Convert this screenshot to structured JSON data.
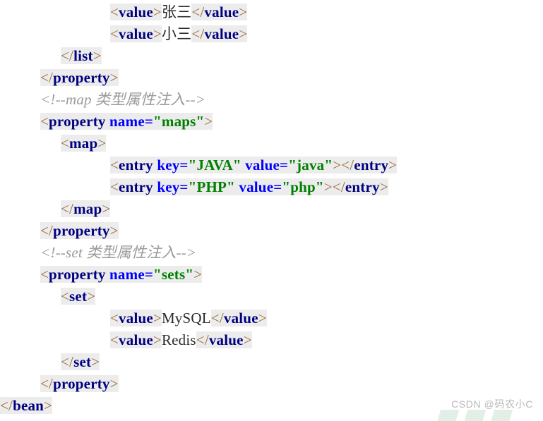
{
  "code": {
    "language": "xml",
    "lines": [
      {
        "indent": 5,
        "tokens": [
          {
            "t": "brk",
            "s": "<",
            "hl": true
          },
          {
            "t": "tag",
            "s": "value",
            "hl": true
          },
          {
            "t": "brk",
            "s": ">",
            "hl": true
          },
          {
            "t": "txt",
            "s": "张三",
            "hl": false
          },
          {
            "t": "brk",
            "s": "</",
            "hl": true
          },
          {
            "t": "tag",
            "s": "value",
            "hl": true
          },
          {
            "t": "brk",
            "s": ">",
            "hl": true
          }
        ]
      },
      {
        "indent": 5,
        "tokens": [
          {
            "t": "brk",
            "s": "<",
            "hl": true
          },
          {
            "t": "tag",
            "s": "value",
            "hl": true
          },
          {
            "t": "brk",
            "s": ">",
            "hl": true
          },
          {
            "t": "txt",
            "s": "小三",
            "hl": false
          },
          {
            "t": "brk",
            "s": "</",
            "hl": true
          },
          {
            "t": "tag",
            "s": "value",
            "hl": true
          },
          {
            "t": "brk",
            "s": ">",
            "hl": true
          }
        ]
      },
      {
        "indent": 3,
        "tokens": [
          {
            "t": "brk",
            "s": "</",
            "hl": true
          },
          {
            "t": "tag",
            "s": "list",
            "hl": true
          },
          {
            "t": "brk",
            "s": ">",
            "hl": true
          }
        ]
      },
      {
        "indent": 2,
        "tokens": [
          {
            "t": "brk",
            "s": "</",
            "hl": true
          },
          {
            "t": "tag",
            "s": "property",
            "hl": true
          },
          {
            "t": "brk",
            "s": ">",
            "hl": true
          }
        ]
      },
      {
        "indent": 2,
        "tokens": [
          {
            "t": "cmt",
            "s": "<!--map 类型属性注入-->",
            "hl": false
          }
        ]
      },
      {
        "indent": 2,
        "tokens": [
          {
            "t": "brk",
            "s": "<",
            "hl": true
          },
          {
            "t": "tag",
            "s": "property",
            "hl": true
          },
          {
            "t": "txt",
            "s": " ",
            "hl": true
          },
          {
            "t": "attr",
            "s": "name=",
            "hl": true
          },
          {
            "t": "val",
            "s": "\"maps\"",
            "hl": true
          },
          {
            "t": "brk",
            "s": ">",
            "hl": true
          }
        ]
      },
      {
        "indent": 3,
        "tokens": [
          {
            "t": "brk",
            "s": "<",
            "hl": true
          },
          {
            "t": "tag",
            "s": "map",
            "hl": true
          },
          {
            "t": "brk",
            "s": ">",
            "hl": true
          }
        ]
      },
      {
        "indent": 5,
        "tokens": [
          {
            "t": "brk",
            "s": "<",
            "hl": true
          },
          {
            "t": "tag",
            "s": "entry",
            "hl": true
          },
          {
            "t": "txt",
            "s": " ",
            "hl": true
          },
          {
            "t": "attr",
            "s": "key=",
            "hl": true
          },
          {
            "t": "val",
            "s": "\"JAVA\"",
            "hl": true
          },
          {
            "t": "txt",
            "s": " ",
            "hl": true
          },
          {
            "t": "attr",
            "s": "value=",
            "hl": true
          },
          {
            "t": "val",
            "s": "\"java\"",
            "hl": true
          },
          {
            "t": "brk",
            "s": ">",
            "hl": true
          },
          {
            "t": "brk",
            "s": "</",
            "hl": true
          },
          {
            "t": "tag",
            "s": "entry",
            "hl": true
          },
          {
            "t": "brk",
            "s": ">",
            "hl": true
          }
        ]
      },
      {
        "indent": 5,
        "tokens": [
          {
            "t": "brk",
            "s": "<",
            "hl": true
          },
          {
            "t": "tag",
            "s": "entry",
            "hl": true
          },
          {
            "t": "txt",
            "s": " ",
            "hl": true
          },
          {
            "t": "attr",
            "s": "key=",
            "hl": true
          },
          {
            "t": "val",
            "s": "\"PHP\"",
            "hl": true
          },
          {
            "t": "txt",
            "s": " ",
            "hl": true
          },
          {
            "t": "attr",
            "s": "value=",
            "hl": true
          },
          {
            "t": "val",
            "s": "\"php\"",
            "hl": true
          },
          {
            "t": "brk",
            "s": ">",
            "hl": true
          },
          {
            "t": "brk",
            "s": "</",
            "hl": true
          },
          {
            "t": "tag",
            "s": "entry",
            "hl": true
          },
          {
            "t": "brk",
            "s": ">",
            "hl": true
          }
        ]
      },
      {
        "indent": 3,
        "tokens": [
          {
            "t": "brk",
            "s": "</",
            "hl": true
          },
          {
            "t": "tag",
            "s": "map",
            "hl": true
          },
          {
            "t": "brk",
            "s": ">",
            "hl": true
          }
        ]
      },
      {
        "indent": 2,
        "tokens": [
          {
            "t": "brk",
            "s": "</",
            "hl": true
          },
          {
            "t": "tag",
            "s": "property",
            "hl": true
          },
          {
            "t": "brk",
            "s": ">",
            "hl": true
          }
        ]
      },
      {
        "indent": 2,
        "tokens": [
          {
            "t": "cmt",
            "s": "<!--set 类型属性注入-->",
            "hl": false
          }
        ]
      },
      {
        "indent": 2,
        "tokens": [
          {
            "t": "brk",
            "s": "<",
            "hl": true
          },
          {
            "t": "tag",
            "s": "property",
            "hl": true
          },
          {
            "t": "txt",
            "s": " ",
            "hl": true
          },
          {
            "t": "attr",
            "s": "name=",
            "hl": true
          },
          {
            "t": "val",
            "s": "\"sets\"",
            "hl": true
          },
          {
            "t": "brk",
            "s": ">",
            "hl": true
          }
        ]
      },
      {
        "indent": 3,
        "tokens": [
          {
            "t": "brk",
            "s": "<",
            "hl": true
          },
          {
            "t": "tag",
            "s": "set",
            "hl": true
          },
          {
            "t": "brk",
            "s": ">",
            "hl": true
          }
        ]
      },
      {
        "indent": 5,
        "tokens": [
          {
            "t": "brk",
            "s": "<",
            "hl": true
          },
          {
            "t": "tag",
            "s": "value",
            "hl": true
          },
          {
            "t": "brk",
            "s": ">",
            "hl": true
          },
          {
            "t": "txt",
            "s": "MySQL",
            "hl": false
          },
          {
            "t": "brk",
            "s": "</",
            "hl": true
          },
          {
            "t": "tag",
            "s": "value",
            "hl": true
          },
          {
            "t": "brk",
            "s": ">",
            "hl": true
          }
        ]
      },
      {
        "indent": 5,
        "tokens": [
          {
            "t": "brk",
            "s": "<",
            "hl": true
          },
          {
            "t": "tag",
            "s": "value",
            "hl": true
          },
          {
            "t": "brk",
            "s": ">",
            "hl": true
          },
          {
            "t": "txt",
            "s": "Redis",
            "hl": false
          },
          {
            "t": "brk",
            "s": "</",
            "hl": true
          },
          {
            "t": "tag",
            "s": "value",
            "hl": true
          },
          {
            "t": "brk",
            "s": ">",
            "hl": true
          }
        ]
      },
      {
        "indent": 3,
        "tokens": [
          {
            "t": "brk",
            "s": "</",
            "hl": true
          },
          {
            "t": "tag",
            "s": "set",
            "hl": true
          },
          {
            "t": "brk",
            "s": ">",
            "hl": true
          }
        ]
      },
      {
        "indent": 2,
        "tokens": [
          {
            "t": "brk",
            "s": "</",
            "hl": true
          },
          {
            "t": "tag",
            "s": "property",
            "hl": true
          },
          {
            "t": "brk",
            "s": ">",
            "hl": true
          }
        ]
      },
      {
        "indent": 0,
        "tokens": [
          {
            "t": "brk",
            "s": "</",
            "hl": true
          },
          {
            "t": "tag",
            "s": "bean",
            "hl": true
          },
          {
            "t": "brk",
            "s": ">",
            "hl": true
          }
        ]
      }
    ]
  },
  "watermark": {
    "text": "CSDN @码农小C"
  },
  "colors": {
    "background": "#ffffff",
    "highlight": "#ececec",
    "tag": "#000080",
    "attribute": "#0000ff",
    "attribute_value": "#008000",
    "text_content": "#2b2b2b",
    "comment": "#9a9a9a",
    "bracket": "#9a6a3a",
    "watermark": "#b8b8b8",
    "watermark_deco": "#e2efe6"
  }
}
